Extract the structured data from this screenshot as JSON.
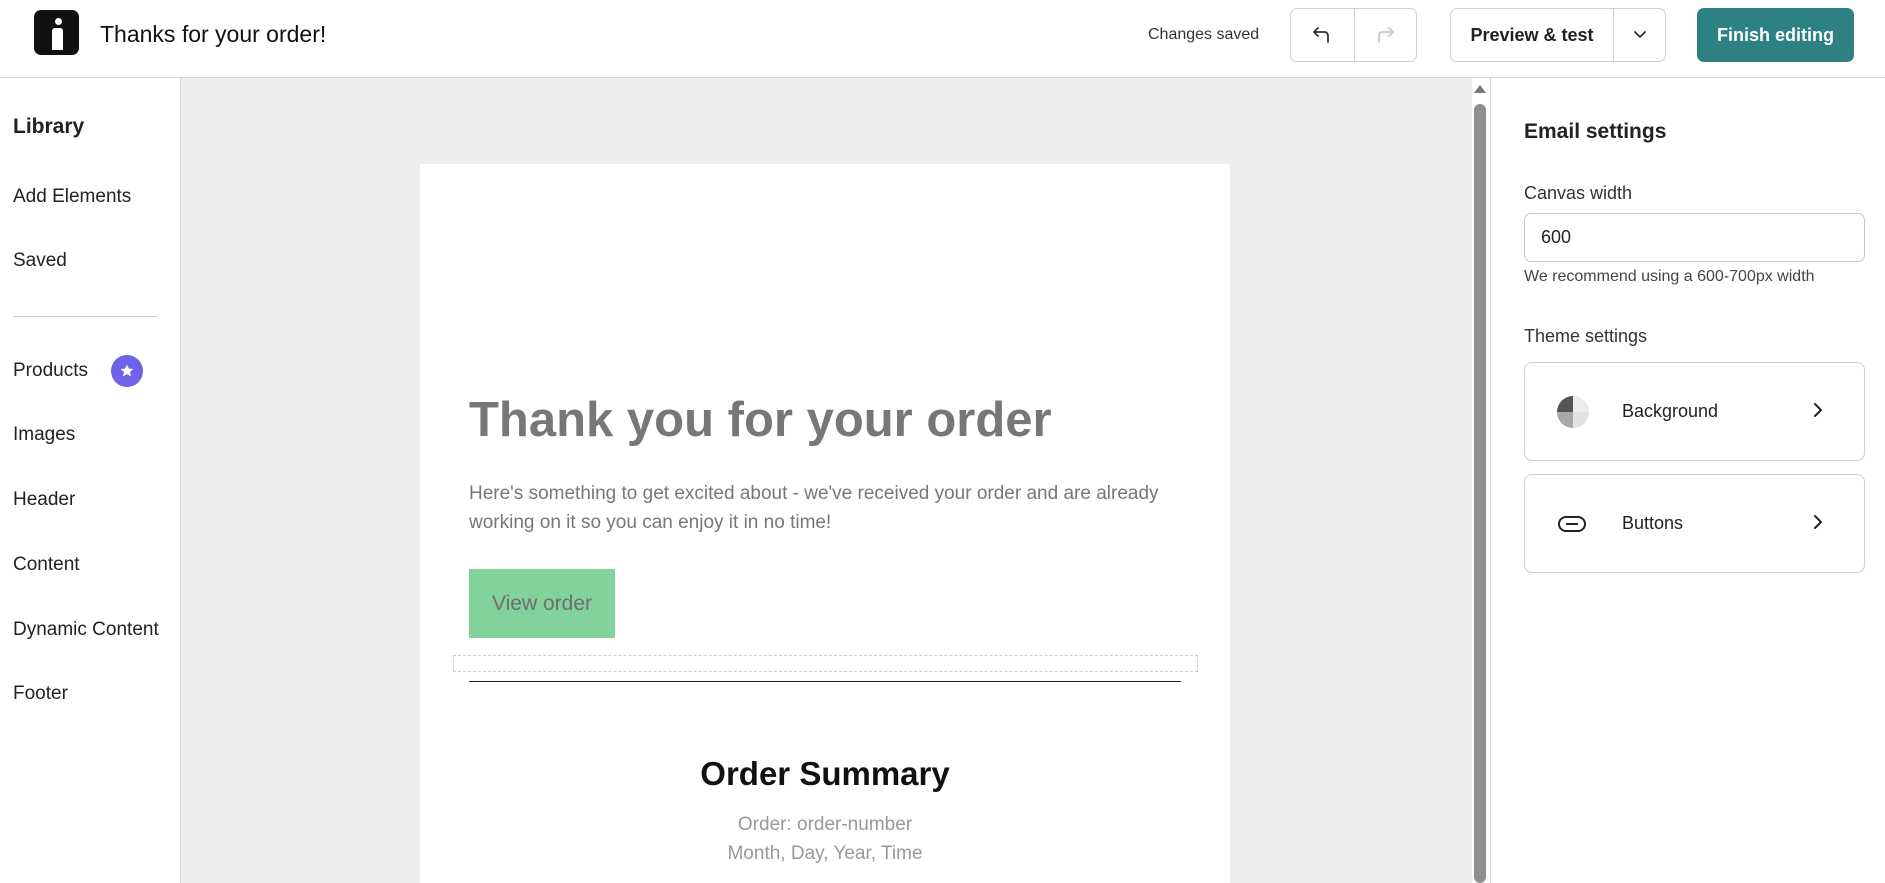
{
  "header": {
    "title": "Thanks for your order!",
    "status": "Changes saved",
    "undo_icon": "undo-icon",
    "redo_icon": "redo-icon",
    "preview_label": "Preview & test",
    "finish_label": "Finish editing",
    "accent_color": "#2e8183"
  },
  "sidebar": {
    "title": "Library",
    "items": [
      {
        "label": "Add Elements"
      },
      {
        "label": "Saved"
      },
      {
        "label": "Products",
        "badge_icon": "star-icon"
      },
      {
        "label": "Images"
      },
      {
        "label": "Header"
      },
      {
        "label": "Content"
      },
      {
        "label": "Dynamic Content"
      },
      {
        "label": "Footer"
      }
    ]
  },
  "email": {
    "hero_title": "Thank you for your order",
    "hero_body": "Here's something to get excited about - we've received your order and are already working on it so you can enjoy it in no time!",
    "button_label": "View order",
    "button_color": "#81d39b",
    "summary_title": "Order Summary",
    "order_line": "Order: order-number",
    "date_line": "Month, Day, Year, Time"
  },
  "settings": {
    "title": "Email settings",
    "canvas_width_label": "Canvas width",
    "canvas_width_value": "600",
    "canvas_width_hint": "We recommend using a 600-700px width",
    "theme_label": "Theme settings",
    "theme_items": [
      {
        "label": "Background",
        "icon": "palette-icon"
      },
      {
        "label": "Buttons",
        "icon": "button-shape-icon"
      }
    ]
  }
}
